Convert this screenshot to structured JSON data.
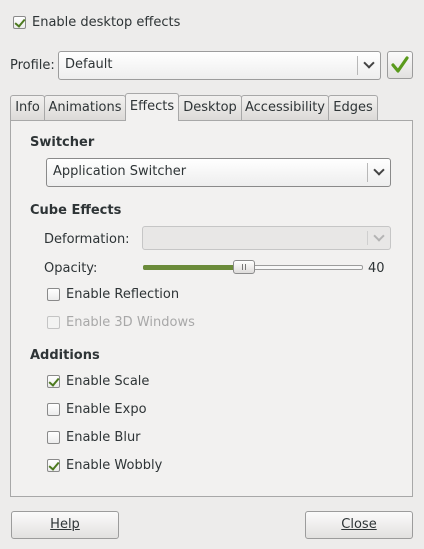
{
  "top": {
    "enable_effects_label": "Enable desktop effects",
    "enable_effects_checked": true
  },
  "profile": {
    "label": "Profile:",
    "value": "Default"
  },
  "tabs": [
    {
      "label": "Info"
    },
    {
      "label": "Animations"
    },
    {
      "label": "Effects",
      "active": true
    },
    {
      "label": "Desktop"
    },
    {
      "label": "Accessibility"
    },
    {
      "label": "Edges"
    }
  ],
  "switcher": {
    "heading": "Switcher",
    "selected": "Application Switcher"
  },
  "cube": {
    "heading": "Cube Effects",
    "deformation_label": "Deformation:",
    "deformation_value": "",
    "opacity_label": "Opacity:",
    "opacity_value": "40",
    "opacity_fraction": 0.4,
    "reflection_label": "Enable Reflection",
    "reflection_checked": false,
    "windows3d_label": "Enable 3D Windows",
    "windows3d_checked": false
  },
  "additions": {
    "heading": "Additions",
    "items": [
      {
        "label": "Enable Scale",
        "checked": true
      },
      {
        "label": "Enable Expo",
        "checked": false
      },
      {
        "label": "Enable Blur",
        "checked": false
      },
      {
        "label": "Enable Wobbly",
        "checked": true
      }
    ]
  },
  "buttons": {
    "help": "Help",
    "close": "Close"
  },
  "colors": {
    "accent_green": "#4d7a1f",
    "slider_fill": "#6b8b3a"
  }
}
